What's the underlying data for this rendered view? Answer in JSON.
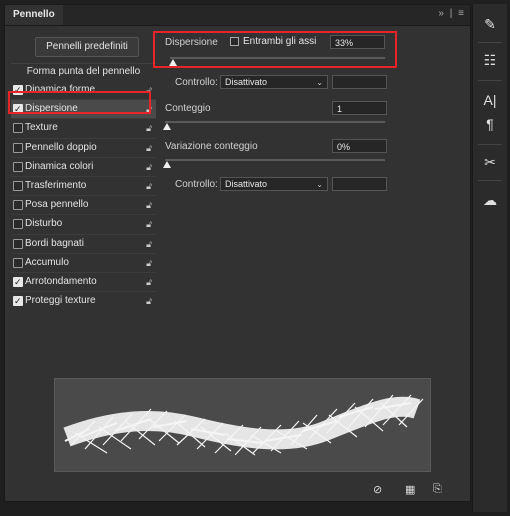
{
  "panel": {
    "title": "Pennello"
  },
  "header": {
    "collapse_icon": "double-chevron-right",
    "menu_icon": "hamburger-menu"
  },
  "presets_button": "Pennelli predefiniti",
  "shape_label": "Forma punta del pennello",
  "options": [
    {
      "label": "Dinamica forme",
      "checked": true
    },
    {
      "label": "Dispersione",
      "checked": true,
      "selected": true
    },
    {
      "label": "Texture",
      "checked": false
    },
    {
      "label": "Pennello doppio",
      "checked": false
    },
    {
      "label": "Dinamica colori",
      "checked": false
    },
    {
      "label": "Trasferimento",
      "checked": false
    },
    {
      "label": "Posa pennello",
      "checked": false
    },
    {
      "label": "Disturbo",
      "checked": false
    },
    {
      "label": "Bordi bagnati",
      "checked": false
    },
    {
      "label": "Accumulo",
      "checked": false
    },
    {
      "label": "Arrotondamento",
      "checked": true
    },
    {
      "label": "Proteggi texture",
      "checked": true
    }
  ],
  "scatter": {
    "label": "Dispersione",
    "both_axes_label": "Entrambi gli assi",
    "value": "33%",
    "control_label": "Controllo:",
    "control_value": "Disattivato"
  },
  "count": {
    "label": "Conteggio",
    "value": "1"
  },
  "count_jitter": {
    "label": "Variazione conteggio",
    "value": "0%",
    "control_label": "Controllo:",
    "control_value": "Disattivato"
  },
  "footer_icons": [
    "eye-icon",
    "grid-icon",
    "new-brush-icon"
  ],
  "toolbar_icons": [
    "brush-icon",
    "brush-presets-icon",
    "character-icon",
    "paragraph-icon",
    "tools-icon",
    "libraries-icon"
  ],
  "colors": {
    "accent_red": "#e8232a",
    "panel_bg": "#323232"
  }
}
